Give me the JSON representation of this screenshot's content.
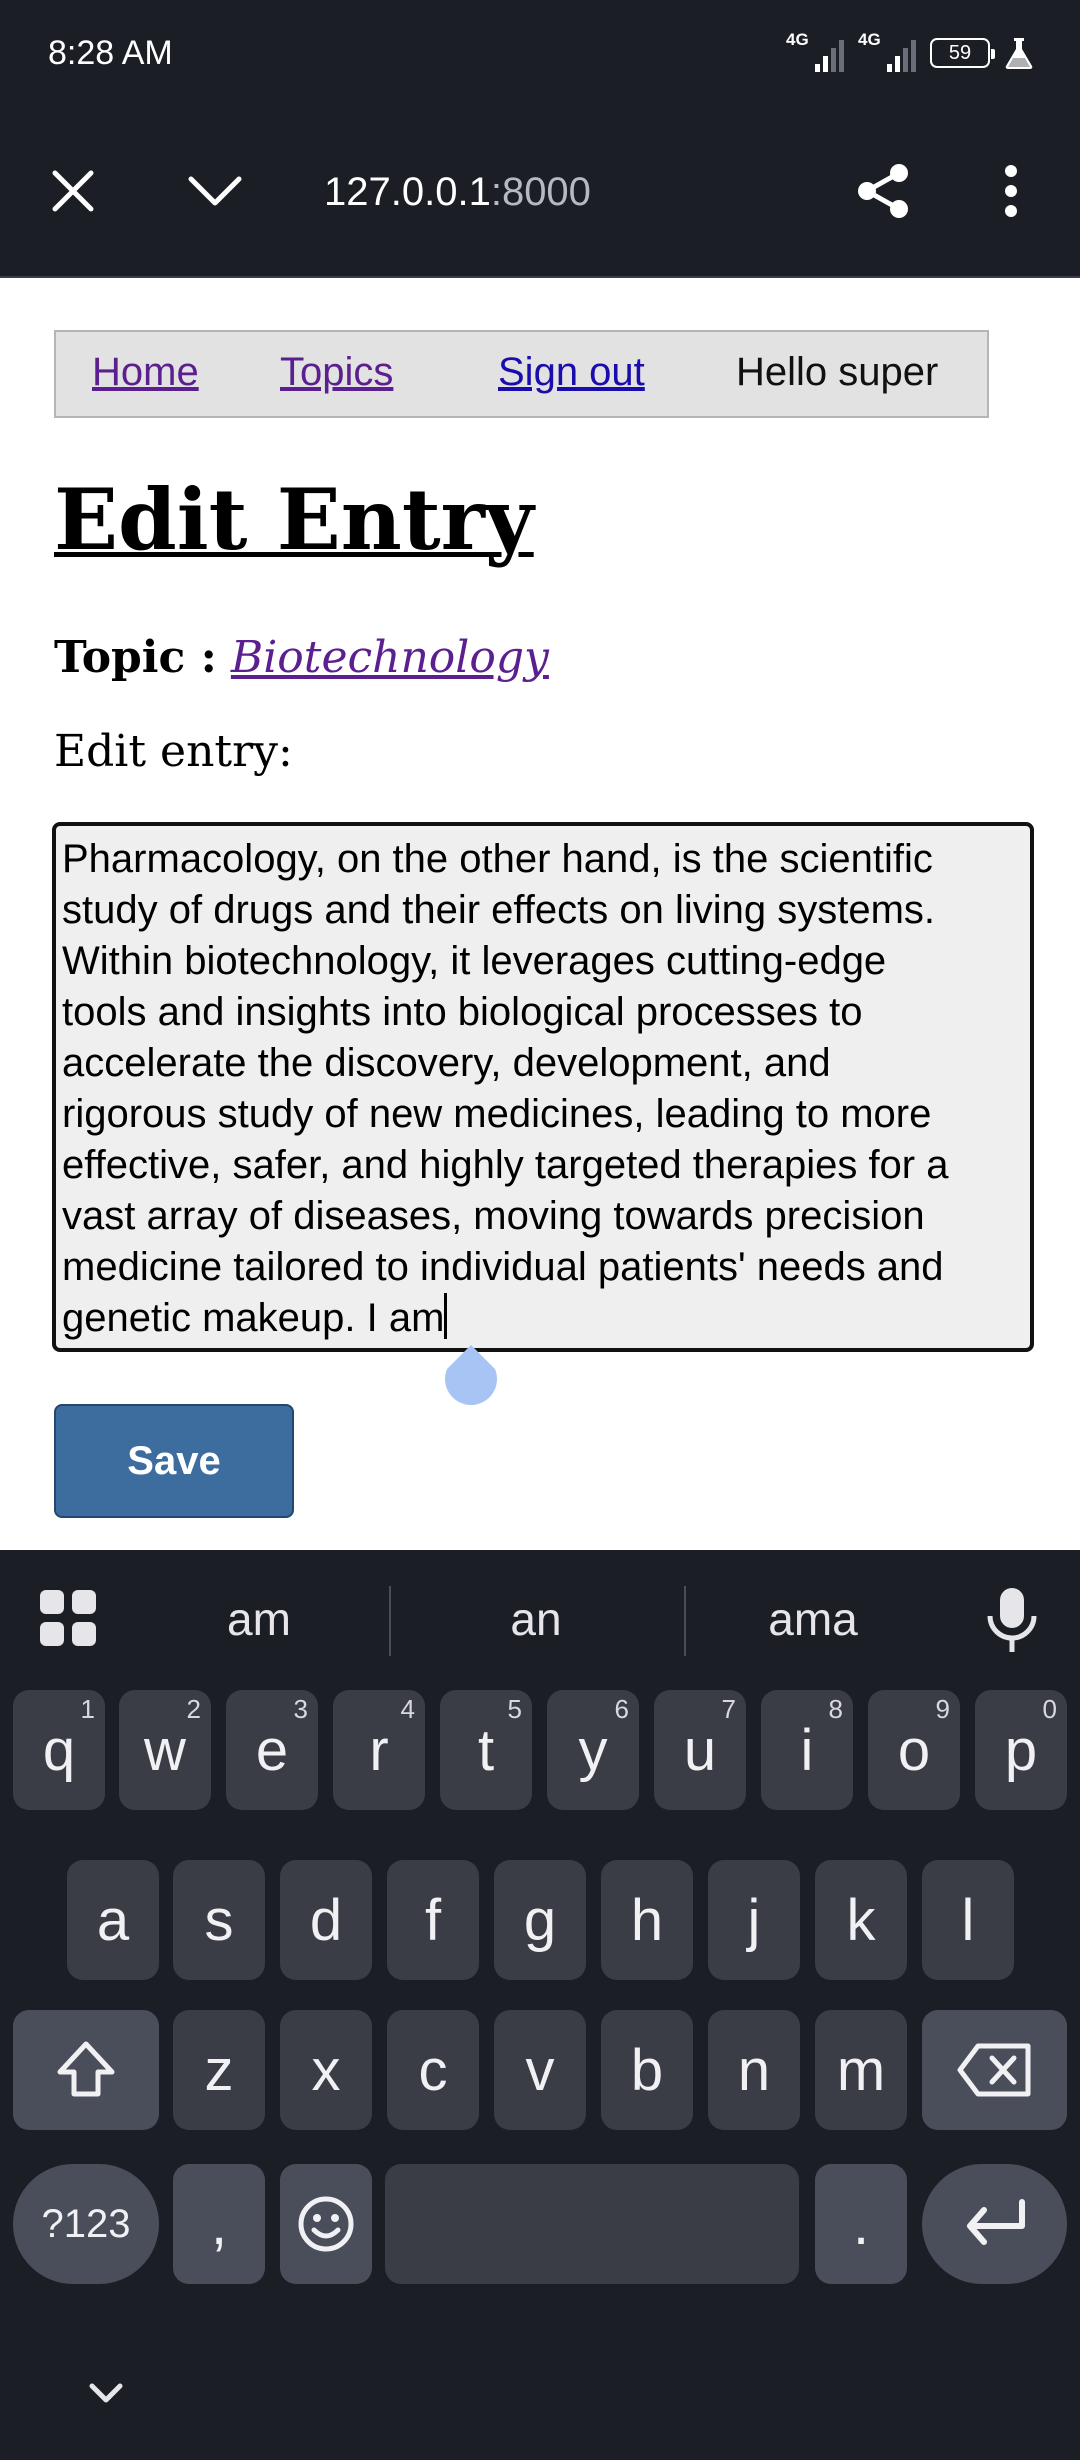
{
  "status_bar": {
    "time": "8:28 AM",
    "signal1_label": "4G",
    "signal2_label": "4G",
    "battery": "59",
    "icons": [
      "signal-icon",
      "signal-icon",
      "battery-icon",
      "flask-icon"
    ]
  },
  "browser": {
    "url_host": "127.0.0.1",
    "url_port": ":8000",
    "icons": [
      "close-icon",
      "chevron-down-icon",
      "share-icon",
      "more-vert-icon"
    ]
  },
  "nav": {
    "home": "Home",
    "topics": "Topics",
    "sign_out": "Sign out",
    "hello": "Hello super"
  },
  "page": {
    "title": "Edit Entry",
    "topic_label": "Topic :",
    "topic_value": "Biotechnology",
    "edit_label": "Edit entry:",
    "textarea_text": "Pharmacology, on the other hand, is the scientific\nstudy of drugs and their effects on living systems.\nWithin biotechnology, it leverages cutting-edge\ntools and insights into biological processes to\naccelerate the discovery, development, and\nrigorous study of new medicines, leading to more\neffective, safer, and highly targeted therapies for a\nvast array of diseases, moving towards precision\nmedicine tailored to individual patients' needs and\ngenetic makeup. I am",
    "save_label": "Save"
  },
  "keyboard": {
    "suggestions": [
      "am",
      "an",
      "ama"
    ],
    "row1": [
      {
        "key": "q",
        "hint": "1"
      },
      {
        "key": "w",
        "hint": "2"
      },
      {
        "key": "e",
        "hint": "3"
      },
      {
        "key": "r",
        "hint": "4"
      },
      {
        "key": "t",
        "hint": "5"
      },
      {
        "key": "y",
        "hint": "6"
      },
      {
        "key": "u",
        "hint": "7"
      },
      {
        "key": "i",
        "hint": "8"
      },
      {
        "key": "o",
        "hint": "9"
      },
      {
        "key": "p",
        "hint": "0"
      }
    ],
    "row2": [
      "a",
      "s",
      "d",
      "f",
      "g",
      "h",
      "j",
      "k",
      "l"
    ],
    "row3": [
      "z",
      "x",
      "c",
      "v",
      "b",
      "n",
      "m"
    ],
    "symbols_label": "?123",
    "comma": ",",
    "period": ".",
    "accent_color": "#a8c4f4"
  }
}
